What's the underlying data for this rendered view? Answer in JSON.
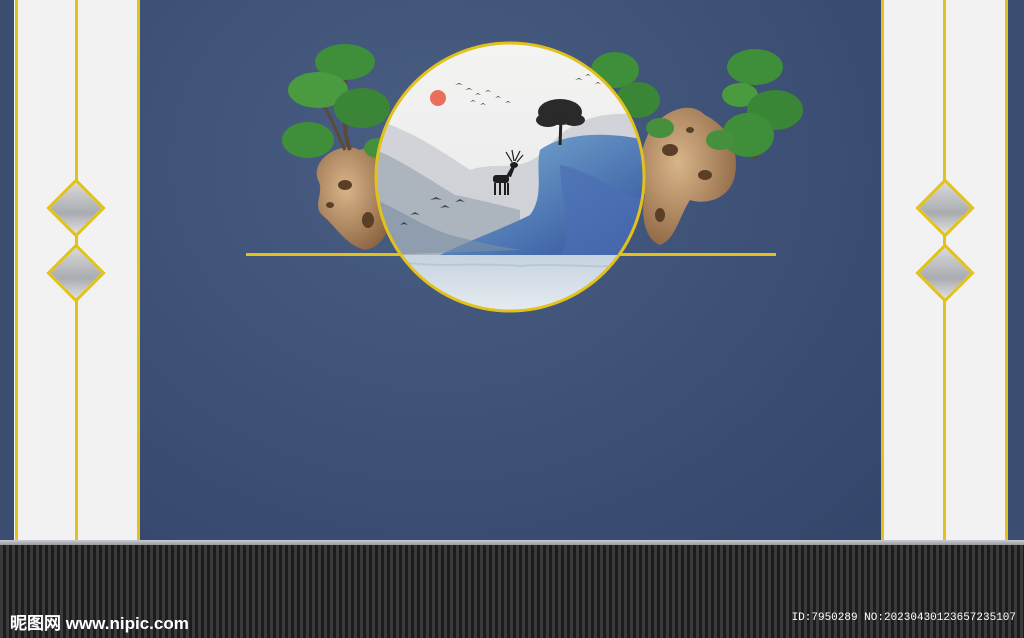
{
  "watermark": {
    "site": "昵图网 www.nipic.com",
    "id_text": "ID:7950289 NO:20230430123657235107"
  },
  "colors": {
    "wall_blue": "#3f5278",
    "gold": "#e2c21a",
    "panel_white": "#f2f2f2",
    "tree_green": "#3f8f3a",
    "rock_brown": "#b48a5c"
  },
  "icons": [
    "deer-silhouette",
    "tree-silhouette",
    "bonsai-tree",
    "scholar-rock",
    "sun",
    "birds"
  ]
}
